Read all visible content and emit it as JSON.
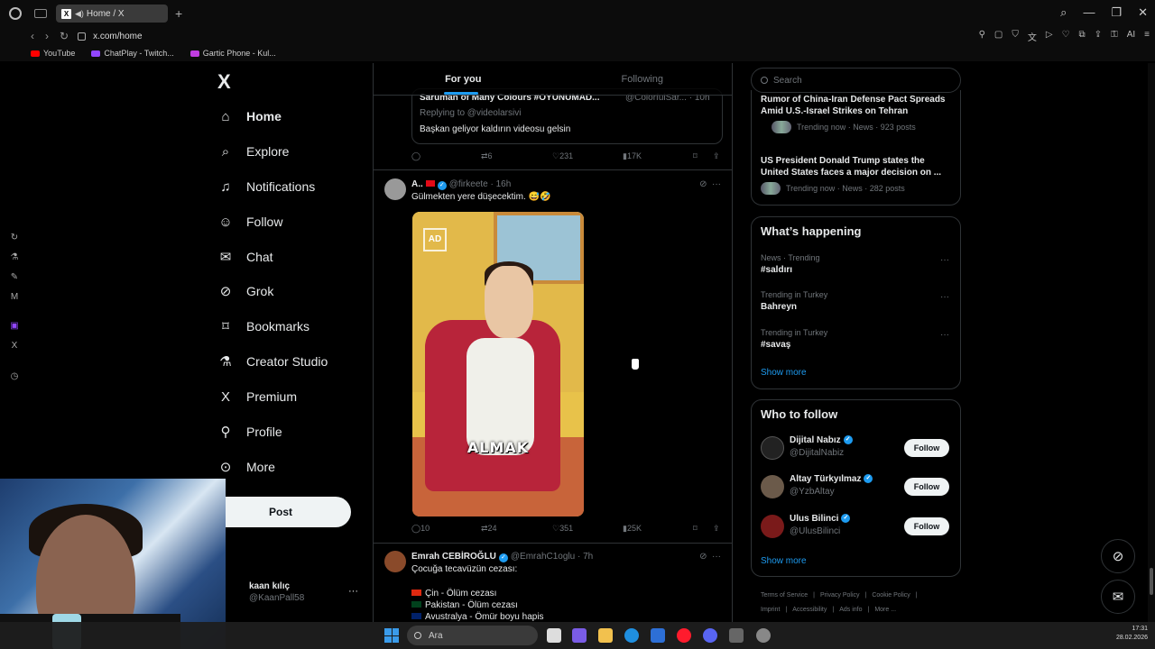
{
  "browser": {
    "tab_title": "Home / X",
    "url": "x.com/home",
    "bookmarks": [
      {
        "label": "YouTube",
        "color": "#ff0000"
      },
      {
        "label": "ChatPlay - Twitch...",
        "color": "#9146ff"
      },
      {
        "label": "Gartic Phone - Kul...",
        "color": "#c03de0"
      }
    ]
  },
  "nav": {
    "items": [
      {
        "label": "Home",
        "icon": "home-icon"
      },
      {
        "label": "Explore",
        "icon": "search-icon"
      },
      {
        "label": "Notifications",
        "icon": "bell-icon"
      },
      {
        "label": "Follow",
        "icon": "person-plus-icon"
      },
      {
        "label": "Chat",
        "icon": "mail-icon"
      },
      {
        "label": "Grok",
        "icon": "grok-icon"
      },
      {
        "label": "Bookmarks",
        "icon": "bookmark-icon"
      },
      {
        "label": "Creator Studio",
        "icon": "flask-icon"
      },
      {
        "label": "Premium",
        "icon": "x-icon"
      },
      {
        "label": "Profile",
        "icon": "person-icon"
      },
      {
        "label": "More",
        "icon": "more-circle-icon"
      }
    ],
    "post_label": "Post",
    "account_name": "kaan kılıç",
    "account_handle": "@KaanPall58"
  },
  "timeline": {
    "tabs": [
      "For you",
      "Following"
    ],
    "quote": {
      "author": "Saruman of Many Colours #OYUNUMAD...",
      "handle": "@ColorfulSar...",
      "time": "· 10h",
      "replying": "Replying to @videolarsivi",
      "text": "Başkan geliyor kaldırın videosu gelsin"
    },
    "quote_actions": {
      "retweets": "6",
      "likes": "231",
      "views": "17K"
    },
    "tweet1": {
      "name": "A..",
      "handle": "@firkeete",
      "time": "· 16h",
      "text": "Gülmekten yere düşecektim. 😅🤣",
      "media_caption": "ALMAK",
      "media_watermark": "AD",
      "replies": "10",
      "retweets": "24",
      "likes": "351",
      "views": "25K"
    },
    "tweet2": {
      "name": "Emrah CEBİROĞLU",
      "handle": "@EmrahC1oglu",
      "time": "· 7h",
      "text": "Çocuğa tecavüzün cezası:",
      "lines": [
        {
          "text": "Çin - Ölüm cezası",
          "flag": "#de2910"
        },
        {
          "text": "Pakistan - Ölüm cezası",
          "flag": "#01411c"
        },
        {
          "text": "Avustralya - Ömür boyu hapis",
          "flag": "#012169"
        }
      ]
    }
  },
  "right": {
    "search_placeholder": "Search",
    "news": [
      {
        "title": "Rumor of China-Iran Defense Pact Spreads Amid U.S.-Israel Strikes on Tehran",
        "meta": "Trending now · News · 923 posts"
      },
      {
        "title": "US President Donald Trump states the United States faces a major decision on ...",
        "meta": "Trending now · News · 282 posts"
      }
    ],
    "happening_title": "What’s happening",
    "trends": [
      {
        "context": "News · Trending",
        "topic": "#saldırı"
      },
      {
        "context": "Trending in Turkey",
        "topic": "Bahreyn"
      },
      {
        "context": "Trending in Turkey",
        "topic": "#savaş"
      }
    ],
    "show_more": "Show more",
    "wtf_title": "Who to follow",
    "who_to_follow": [
      {
        "name": "Dijital Nabız",
        "handle": "@DijitalNabiz",
        "color": "#222"
      },
      {
        "name": "Altay Türkyılmaz",
        "handle": "@YzbAltay",
        "color": "#6b5a4a"
      },
      {
        "name": "Ulus Bilinci",
        "handle": "@UlusBilinci",
        "color": "#7a1a1a"
      }
    ],
    "follow_label": "Follow",
    "footer": [
      "Terms of Service",
      "|",
      "Privacy Policy",
      "|",
      "Cookie Policy",
      "|",
      "Imprint",
      "|",
      "Accessibility",
      "|",
      "Ads info",
      "|",
      "More ..."
    ]
  },
  "taskbar": {
    "search_placeholder": "Ara",
    "time": "17:31",
    "date": "28.02.2026"
  }
}
